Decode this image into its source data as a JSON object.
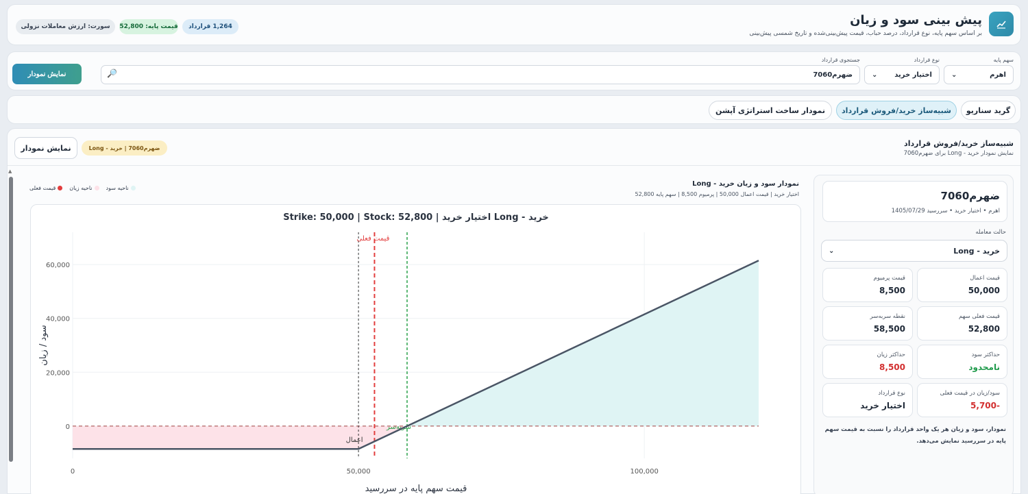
{
  "header": {
    "title": "پیش بینی سود و زیان",
    "subtitle": "بر اساس سهم پایه، نوع قرارداد، درصد حباب، قیمت پیش‌بینی‌شده و تاریخ شمسی پیش‌بینی",
    "pills": {
      "count": "1,264 قرارداد",
      "base_price": "قیمت پایه: 52,800",
      "sort": "سورت: ارزش معاملات نزولی"
    }
  },
  "filters": {
    "stock_label": "سهم پایه",
    "stock_value": "اهرم",
    "type_label": "نوع قرارداد",
    "type_value": "اختیار خرید",
    "search_label": "جستجوی قرارداد",
    "search_value": "ضهرم7060",
    "show_button": "نمایش نمودار"
  },
  "tabs": {
    "grid": "گرید سناریو",
    "simulator": "شبیه‌ساز خرید/فروش قرارداد",
    "strategy": "نمودار ساخت استراتژی آپشن"
  },
  "main": {
    "title": "شبیه‌ساز خرید/فروش قرارداد",
    "subtitle": "نمایش نمودار خرید - Long برای ضهرم7060",
    "badge": "ضهرم7060 | خرید - Long",
    "show_button": "نمایش نمودار"
  },
  "panel": {
    "name": "ضهرم7060",
    "meta": "اهرم • اختیار خرید • سررسید 1405/07/29",
    "state_label": "حالت معامله",
    "state_value": "خرید - Long",
    "stats": {
      "strike_label": "قیمت اعمال",
      "strike_value": "50,000",
      "premium_label": "قیمت پرمیوم",
      "premium_value": "8,500",
      "current_label": "قیمت فعلی سهم",
      "current_value": "52,800",
      "breakeven_label": "نقطه سربه‌سر",
      "breakeven_value": "58,500",
      "maxprofit_label": "حداکثر سود",
      "maxprofit_value": "نامحدود",
      "maxloss_label": "حداکثر زیان",
      "maxloss_value": "8,500",
      "pnl_label": "سود/زیان در قیمت فعلی",
      "pnl_value": "-5,700",
      "ctype_label": "نوع قرارداد",
      "ctype_value": "اختیار خرید"
    },
    "note": "نمودار، سود و زیان هر یک واحد قرارداد را نسبت به قیمت سهم پایه در سررسید نمایش می‌دهد."
  },
  "chart_header": {
    "title": "نمودار سود و زیان خرید - Long",
    "subtitle": "اختیار خرید | قیمت اعمال 50,000 | پرمیوم 8,500 | سهم پایه 52,800",
    "legend_profit": "ناحیه سود",
    "legend_loss": "ناحیه زیان",
    "legend_current": "قیمت فعلی"
  },
  "colors": {
    "line": "#4a5565",
    "profit_fill": "#dff4f4",
    "loss_fill": "#fde2e8",
    "current": "#e23d3d",
    "breakeven": "#2aa14a",
    "strike": "#333333"
  },
  "chart_data": {
    "type": "line",
    "title": "خرید - Long اختیار خرید | Strike: 50,000 | Stock: 52,800",
    "xlabel": "قیمت سهم پایه در سررسید",
    "ylabel": "سود / زیان",
    "x_ticks": [
      0,
      50000,
      100000
    ],
    "x_tick_labels": [
      "0",
      "50,000",
      "100,000"
    ],
    "y_ticks": [
      0,
      20000,
      40000,
      60000
    ],
    "y_tick_labels": [
      "0",
      "20,000",
      "40,000",
      "60,000"
    ],
    "xlim": [
      0,
      120000
    ],
    "ylim": [
      -12000,
      72000
    ],
    "series": [
      {
        "x": [
          0,
          50000,
          120000
        ],
        "y": [
          -8500,
          -8500,
          61500
        ]
      }
    ],
    "markers": {
      "strike": {
        "x": 50000,
        "label": "اعمال"
      },
      "current": {
        "x": 52800,
        "label": "قیمت فعلی"
      },
      "breakeven": {
        "x": 58500,
        "label": "سربه‌سر"
      }
    },
    "grid": true
  }
}
